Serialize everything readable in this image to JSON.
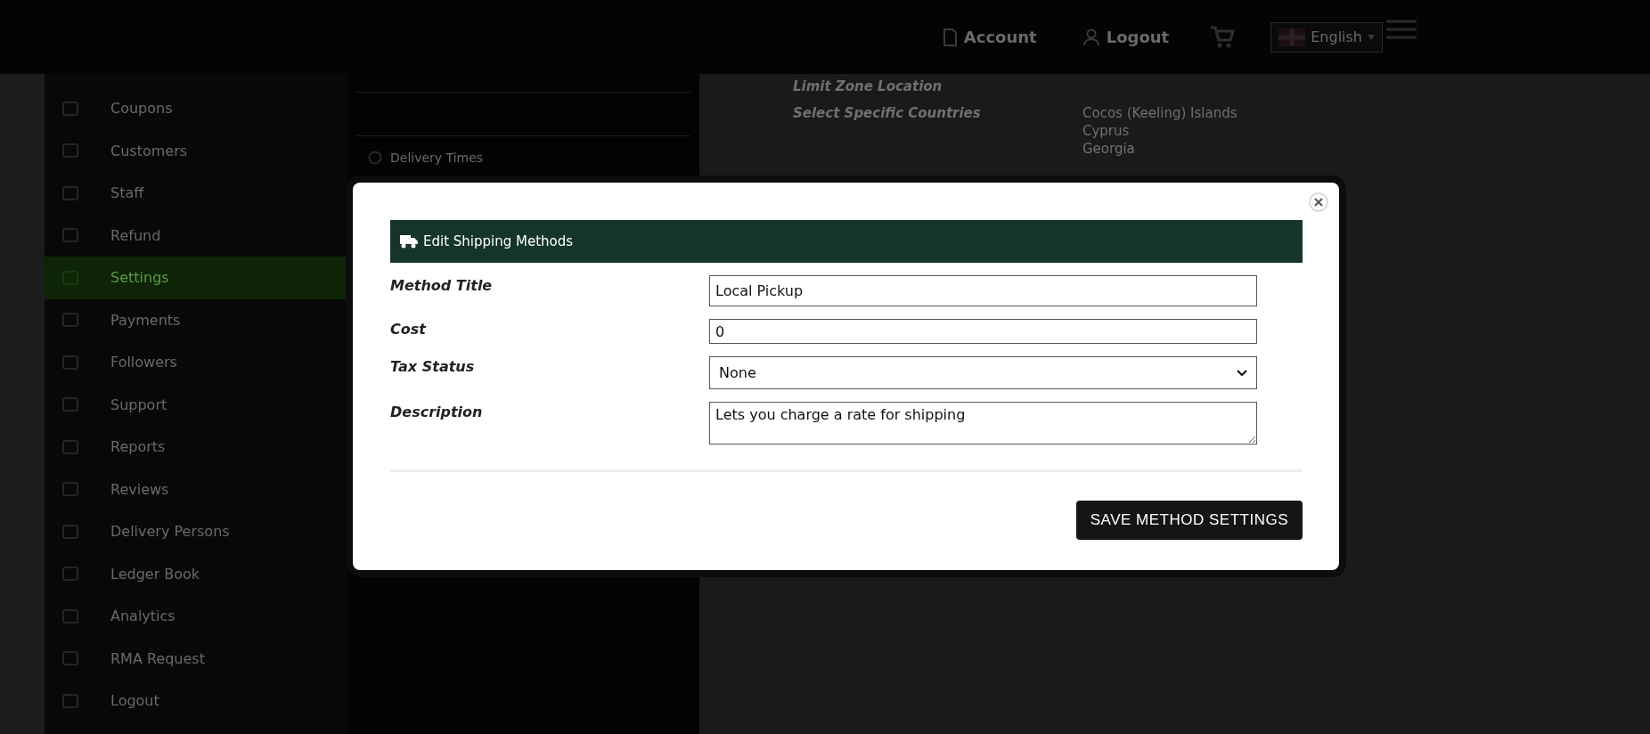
{
  "header": {
    "nav": [
      {
        "kind": "account",
        "label": "Account"
      },
      {
        "kind": "logout",
        "label": "Logout"
      }
    ],
    "language": "English"
  },
  "sidebar": {
    "items": [
      {
        "label": "Coupons",
        "selected": false
      },
      {
        "label": "Customers",
        "selected": false
      },
      {
        "label": "Staff",
        "selected": false
      },
      {
        "label": "Refund",
        "selected": false
      },
      {
        "label": "Settings",
        "selected": true
      },
      {
        "label": "Payments",
        "selected": false
      },
      {
        "label": "Followers",
        "selected": false
      },
      {
        "label": "Support",
        "selected": false
      },
      {
        "label": "Reports",
        "selected": false
      },
      {
        "label": "Reviews",
        "selected": false
      },
      {
        "label": "Delivery Persons",
        "selected": false
      },
      {
        "label": "Ledger Book",
        "selected": false
      },
      {
        "label": "Analytics",
        "selected": false
      },
      {
        "label": "RMA Request",
        "selected": false
      },
      {
        "label": "Logout",
        "selected": false
      }
    ]
  },
  "settings_menu": {
    "items": [
      {
        "label": "Delivery Times"
      }
    ]
  },
  "zone": {
    "fields": [
      {
        "label": "Limit Zone Location"
      },
      {
        "label": "Select Specific Countries",
        "options": [
          "Cocos (Keeling) Islands",
          "Cyprus",
          "Georgia"
        ]
      }
    ]
  },
  "modal": {
    "title": "Edit Shipping Methods",
    "fields": [
      {
        "kind": "text",
        "label": "Method Title",
        "value": "Local Pickup"
      },
      {
        "kind": "text",
        "label": "Cost",
        "value": "0"
      },
      {
        "kind": "select",
        "label": "Tax Status",
        "value": "None"
      },
      {
        "kind": "textarea",
        "label": "Description",
        "value": "Lets you charge a rate for shipping"
      }
    ],
    "save_button": "SAVE METHOD SETTINGS"
  }
}
